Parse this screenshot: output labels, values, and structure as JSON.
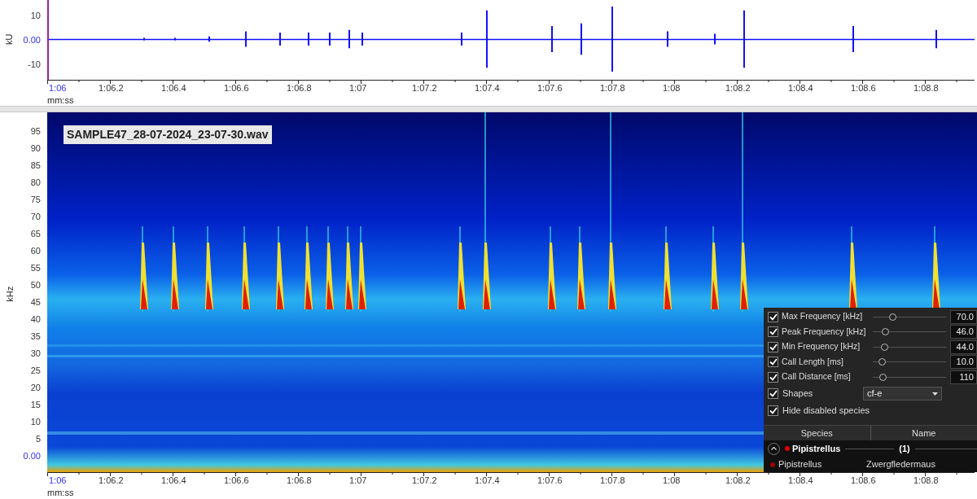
{
  "waveform": {
    "y_axis_label": "kU",
    "y_ticks": [
      {
        "label": "10",
        "highlighted": false
      },
      {
        "label": "0.00",
        "highlighted": true
      },
      {
        "label": "-10",
        "highlighted": false
      }
    ],
    "x_ticks": [
      {
        "label": "1:06",
        "highlighted": true
      },
      {
        "label": "1:06.2",
        "highlighted": false
      },
      {
        "label": "1:06.4",
        "highlighted": false
      },
      {
        "label": "1:06.6",
        "highlighted": false
      },
      {
        "label": "1:06.8",
        "highlighted": false
      },
      {
        "label": "1:07",
        "highlighted": false
      },
      {
        "label": "1:07.2",
        "highlighted": false
      },
      {
        "label": "1:07.4",
        "highlighted": false
      },
      {
        "label": "1:07.6",
        "highlighted": false
      },
      {
        "label": "1:07.8",
        "highlighted": false
      },
      {
        "label": "1:08",
        "highlighted": false
      },
      {
        "label": "1:08.2",
        "highlighted": false
      },
      {
        "label": "1:08.4",
        "highlighted": false
      },
      {
        "label": "1:08.6",
        "highlighted": false
      },
      {
        "label": "1:08.8",
        "highlighted": false
      }
    ],
    "x_axis_label": "mm:ss"
  },
  "spectrogram": {
    "file_label": "SAMPLE47_28-07-2024_23-07-30.wav",
    "y_axis_label": "kHz",
    "y_ticks": [
      {
        "label": "95",
        "highlighted": false
      },
      {
        "label": "90",
        "highlighted": false
      },
      {
        "label": "85",
        "highlighted": false
      },
      {
        "label": "80",
        "highlighted": false
      },
      {
        "label": "75",
        "highlighted": false
      },
      {
        "label": "70",
        "highlighted": false
      },
      {
        "label": "65",
        "highlighted": false
      },
      {
        "label": "60",
        "highlighted": false
      },
      {
        "label": "55",
        "highlighted": false
      },
      {
        "label": "50",
        "highlighted": false
      },
      {
        "label": "45",
        "highlighted": false
      },
      {
        "label": "40",
        "highlighted": false
      },
      {
        "label": "35",
        "highlighted": false
      },
      {
        "label": "30",
        "highlighted": false
      },
      {
        "label": "25",
        "highlighted": false
      },
      {
        "label": "20",
        "highlighted": false
      },
      {
        "label": "15",
        "highlighted": false
      },
      {
        "label": "10",
        "highlighted": false
      },
      {
        "label": "5",
        "highlighted": false
      },
      {
        "label": "0.00",
        "highlighted": true
      }
    ],
    "x_ticks": [
      {
        "label": "1:06",
        "highlighted": true
      },
      {
        "label": "1:06.2",
        "highlighted": false
      },
      {
        "label": "1:06.4",
        "highlighted": false
      },
      {
        "label": "1:06.6",
        "highlighted": false
      },
      {
        "label": "1:06.8",
        "highlighted": false
      },
      {
        "label": "1:07",
        "highlighted": false
      },
      {
        "label": "1:07.2",
        "highlighted": false
      },
      {
        "label": "1:07.4",
        "highlighted": false
      },
      {
        "label": "1:07.6",
        "highlighted": false
      },
      {
        "label": "1:07.8",
        "highlighted": false
      },
      {
        "label": "1:08",
        "highlighted": false
      },
      {
        "label": "1:08.2",
        "highlighted": false
      },
      {
        "label": "1:08.4",
        "highlighted": false
      },
      {
        "label": "1:08.6",
        "highlighted": false
      },
      {
        "label": "1:08.8",
        "highlighted": false
      }
    ],
    "x_axis_label": "mm:ss"
  },
  "filter_panel": {
    "sliders": [
      {
        "label": "Max Frequency [kHz]",
        "checked": true,
        "level": 0.27,
        "value": "70.0"
      },
      {
        "label": "Peak Frequency [kHz]",
        "checked": true,
        "level": 0.17,
        "value": "46.0"
      },
      {
        "label": "Min Frequency [kHz]",
        "checked": true,
        "level": 0.16,
        "value": "44.0"
      },
      {
        "label": "Call Length [ms]",
        "checked": true,
        "level": 0.12,
        "value": "10.0"
      },
      {
        "label": "Call Distance [ms]",
        "checked": true,
        "level": 0.13,
        "value": "110"
      }
    ],
    "shapes": {
      "label": "Shapes",
      "checked": true,
      "value": "cf-e"
    },
    "hide_disabled": {
      "label": "Hide disabled species",
      "checked": true
    },
    "table": {
      "columns": [
        "Species",
        "Name"
      ],
      "groups": [
        {
          "name": "Pipistrellus",
          "count": "(1)",
          "expanded": true,
          "color": "#e00000",
          "children": [
            {
              "species": "Pipistrellus",
              "name": "Zwergfledermaus",
              "color": "#a00000"
            }
          ]
        }
      ]
    }
  }
}
